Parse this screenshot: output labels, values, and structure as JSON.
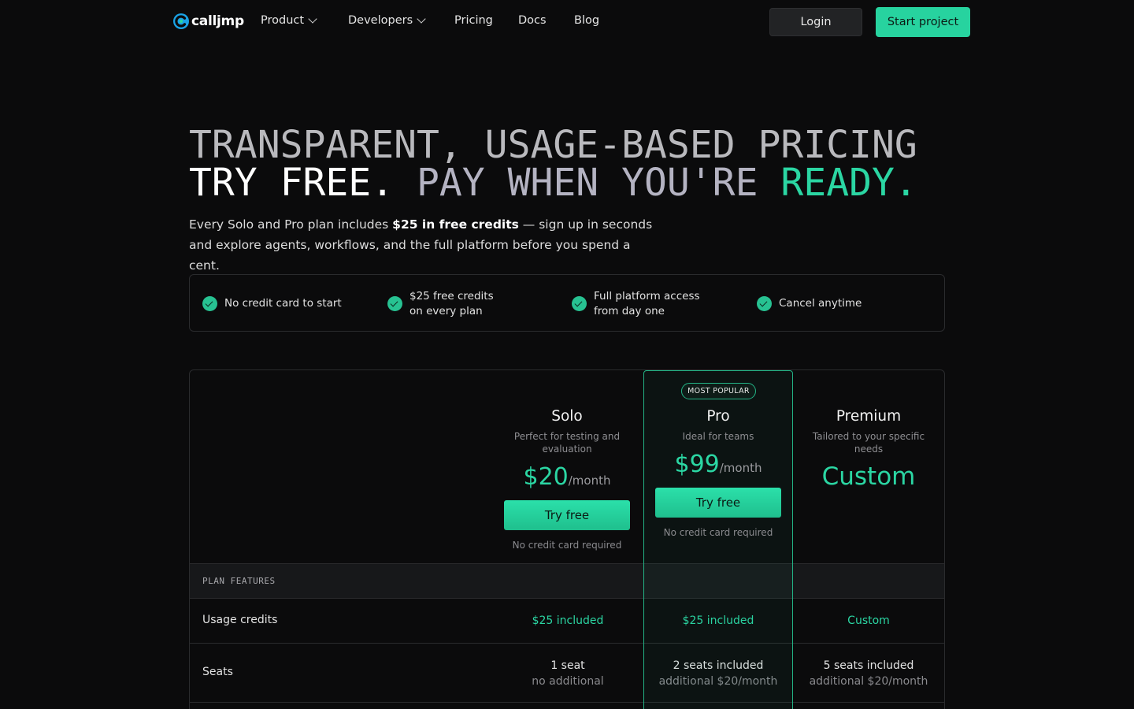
{
  "nav": {
    "logo_text": "calljmp",
    "items": [
      {
        "label": "Product",
        "has_menu": true
      },
      {
        "label": "Developers",
        "has_menu": true
      },
      {
        "label": "Pricing",
        "has_menu": false
      },
      {
        "label": "Docs",
        "has_menu": false
      },
      {
        "label": "Blog",
        "has_menu": false
      }
    ],
    "login_label": "Login",
    "start_label": "Start project"
  },
  "hero": {
    "line1": "TRANSPARENT, USAGE-BASED PRICING",
    "line2_part1": "TRY FREE.",
    "line2_part2": "PAY WHEN YOU'RE",
    "line2_part3": "READY.",
    "lede_before": "Every Solo and Pro plan includes ",
    "lede_bold": "$25 in free credits",
    "lede_after": " — sign up in seconds and explore agents, workflows, and the full platform before you spend a cent."
  },
  "features": [
    {
      "line1": "No credit card to start",
      "line2": ""
    },
    {
      "line1": "$25 free credits",
      "line2": "on every plan"
    },
    {
      "line1": "Full platform access",
      "line2": "from day one"
    },
    {
      "line1": "Cancel anytime",
      "line2": ""
    }
  ],
  "plans": {
    "solo": {
      "name": "Solo",
      "desc": "Perfect for testing and evaluation",
      "price": "$20",
      "period": "/month",
      "cta": "Try free",
      "note": "No credit card required"
    },
    "pro": {
      "badge": "MOST POPULAR",
      "name": "Pro",
      "desc": "Ideal for teams",
      "price": "$99",
      "period": "/month",
      "cta": "Try free",
      "note": "No credit card required"
    },
    "premium": {
      "name": "Premium",
      "desc": "Tailored to your specific needs",
      "price": "Custom"
    }
  },
  "table": {
    "section_label": "PLAN FEATURES",
    "rows": [
      {
        "label": "Usage credits",
        "solo": "$25 included",
        "pro": "$25 included",
        "premium": "Custom"
      },
      {
        "label": "Seats",
        "solo_main": "1 seat",
        "solo_sub": "no additional",
        "pro_main": "2 seats included",
        "pro_sub": "additional $20/month",
        "premium_main": "5 seats included",
        "premium_sub": "additional $20/month"
      }
    ]
  },
  "colors": {
    "accent": "#2bd6a3",
    "background": "#0b0b0c",
    "border": "#2a2b2d"
  }
}
